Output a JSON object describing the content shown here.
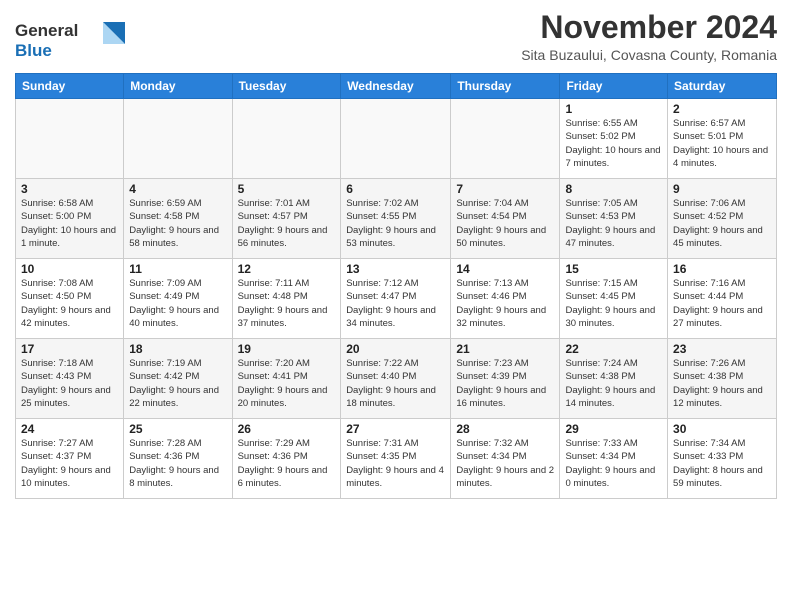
{
  "header": {
    "logo_line1": "General",
    "logo_line2": "Blue",
    "month_title": "November 2024",
    "location": "Sita Buzaului, Covasna County, Romania"
  },
  "weekdays": [
    "Sunday",
    "Monday",
    "Tuesday",
    "Wednesday",
    "Thursday",
    "Friday",
    "Saturday"
  ],
  "weeks": [
    [
      {
        "day": "",
        "info": ""
      },
      {
        "day": "",
        "info": ""
      },
      {
        "day": "",
        "info": ""
      },
      {
        "day": "",
        "info": ""
      },
      {
        "day": "",
        "info": ""
      },
      {
        "day": "1",
        "info": "Sunrise: 6:55 AM\nSunset: 5:02 PM\nDaylight: 10 hours and 7 minutes."
      },
      {
        "day": "2",
        "info": "Sunrise: 6:57 AM\nSunset: 5:01 PM\nDaylight: 10 hours and 4 minutes."
      }
    ],
    [
      {
        "day": "3",
        "info": "Sunrise: 6:58 AM\nSunset: 5:00 PM\nDaylight: 10 hours and 1 minute."
      },
      {
        "day": "4",
        "info": "Sunrise: 6:59 AM\nSunset: 4:58 PM\nDaylight: 9 hours and 58 minutes."
      },
      {
        "day": "5",
        "info": "Sunrise: 7:01 AM\nSunset: 4:57 PM\nDaylight: 9 hours and 56 minutes."
      },
      {
        "day": "6",
        "info": "Sunrise: 7:02 AM\nSunset: 4:55 PM\nDaylight: 9 hours and 53 minutes."
      },
      {
        "day": "7",
        "info": "Sunrise: 7:04 AM\nSunset: 4:54 PM\nDaylight: 9 hours and 50 minutes."
      },
      {
        "day": "8",
        "info": "Sunrise: 7:05 AM\nSunset: 4:53 PM\nDaylight: 9 hours and 47 minutes."
      },
      {
        "day": "9",
        "info": "Sunrise: 7:06 AM\nSunset: 4:52 PM\nDaylight: 9 hours and 45 minutes."
      }
    ],
    [
      {
        "day": "10",
        "info": "Sunrise: 7:08 AM\nSunset: 4:50 PM\nDaylight: 9 hours and 42 minutes."
      },
      {
        "day": "11",
        "info": "Sunrise: 7:09 AM\nSunset: 4:49 PM\nDaylight: 9 hours and 40 minutes."
      },
      {
        "day": "12",
        "info": "Sunrise: 7:11 AM\nSunset: 4:48 PM\nDaylight: 9 hours and 37 minutes."
      },
      {
        "day": "13",
        "info": "Sunrise: 7:12 AM\nSunset: 4:47 PM\nDaylight: 9 hours and 34 minutes."
      },
      {
        "day": "14",
        "info": "Sunrise: 7:13 AM\nSunset: 4:46 PM\nDaylight: 9 hours and 32 minutes."
      },
      {
        "day": "15",
        "info": "Sunrise: 7:15 AM\nSunset: 4:45 PM\nDaylight: 9 hours and 30 minutes."
      },
      {
        "day": "16",
        "info": "Sunrise: 7:16 AM\nSunset: 4:44 PM\nDaylight: 9 hours and 27 minutes."
      }
    ],
    [
      {
        "day": "17",
        "info": "Sunrise: 7:18 AM\nSunset: 4:43 PM\nDaylight: 9 hours and 25 minutes."
      },
      {
        "day": "18",
        "info": "Sunrise: 7:19 AM\nSunset: 4:42 PM\nDaylight: 9 hours and 22 minutes."
      },
      {
        "day": "19",
        "info": "Sunrise: 7:20 AM\nSunset: 4:41 PM\nDaylight: 9 hours and 20 minutes."
      },
      {
        "day": "20",
        "info": "Sunrise: 7:22 AM\nSunset: 4:40 PM\nDaylight: 9 hours and 18 minutes."
      },
      {
        "day": "21",
        "info": "Sunrise: 7:23 AM\nSunset: 4:39 PM\nDaylight: 9 hours and 16 minutes."
      },
      {
        "day": "22",
        "info": "Sunrise: 7:24 AM\nSunset: 4:38 PM\nDaylight: 9 hours and 14 minutes."
      },
      {
        "day": "23",
        "info": "Sunrise: 7:26 AM\nSunset: 4:38 PM\nDaylight: 9 hours and 12 minutes."
      }
    ],
    [
      {
        "day": "24",
        "info": "Sunrise: 7:27 AM\nSunset: 4:37 PM\nDaylight: 9 hours and 10 minutes."
      },
      {
        "day": "25",
        "info": "Sunrise: 7:28 AM\nSunset: 4:36 PM\nDaylight: 9 hours and 8 minutes."
      },
      {
        "day": "26",
        "info": "Sunrise: 7:29 AM\nSunset: 4:36 PM\nDaylight: 9 hours and 6 minutes."
      },
      {
        "day": "27",
        "info": "Sunrise: 7:31 AM\nSunset: 4:35 PM\nDaylight: 9 hours and 4 minutes."
      },
      {
        "day": "28",
        "info": "Sunrise: 7:32 AM\nSunset: 4:34 PM\nDaylight: 9 hours and 2 minutes."
      },
      {
        "day": "29",
        "info": "Sunrise: 7:33 AM\nSunset: 4:34 PM\nDaylight: 9 hours and 0 minutes."
      },
      {
        "day": "30",
        "info": "Sunrise: 7:34 AM\nSunset: 4:33 PM\nDaylight: 8 hours and 59 minutes."
      }
    ]
  ]
}
